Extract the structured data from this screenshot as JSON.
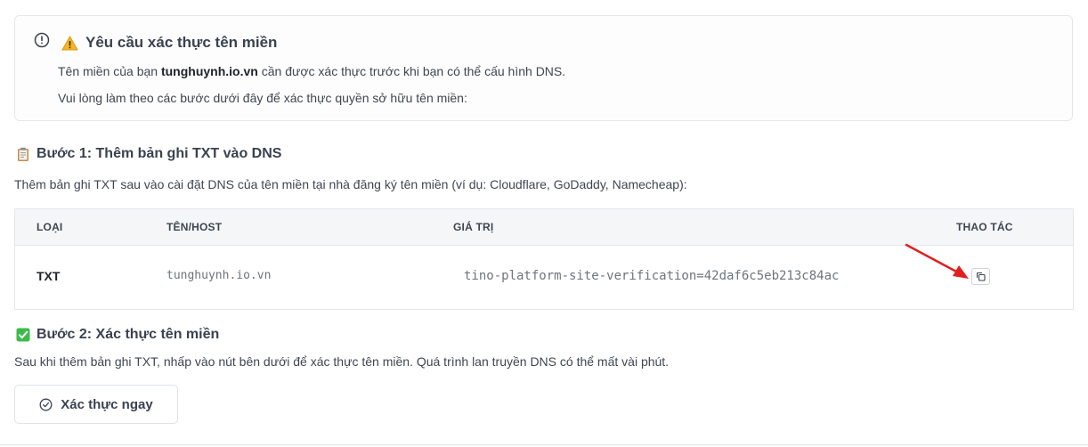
{
  "alert": {
    "title": "Yêu cầu xác thực tên miền",
    "line1_prefix": "Tên miền của bạn ",
    "line1_domain": "tunghuynh.io.vn",
    "line1_suffix": " cần được xác thực trước khi bạn có thể cấu hình DNS.",
    "line2": "Vui lòng làm theo các bước dưới đây để xác thực quyền sở hữu tên miền:"
  },
  "step1": {
    "title": "Bước 1: Thêm bản ghi TXT vào DNS",
    "description": "Thêm bản ghi TXT sau vào cài đặt DNS của tên miền tại nhà đăng ký tên miền (ví dụ: Cloudflare, GoDaddy, Namecheap):"
  },
  "table": {
    "headers": [
      "LOẠI",
      "TÊN/HOST",
      "GIÁ TRỊ",
      "THAO TÁC"
    ],
    "row": {
      "type": "TXT",
      "host": "tunghuynh.io.vn",
      "value": "tino-platform-site-verification=42daf6c5eb213c84ac"
    }
  },
  "step2": {
    "title": "Bước 2: Xác thực tên miền",
    "description": "Sau khi thêm bản ghi TXT, nhấp vào nút bên dưới để xác thực tên miền. Quá trình lan truyền DNS có thể mất vài phút."
  },
  "verify_button": {
    "label": "Xác thực ngay"
  },
  "icons": {
    "alert": "info-circle-icon",
    "warning": "warning-icon",
    "step1": "clipboard-icon",
    "step2": "check-box-icon",
    "copy": "copy-icon",
    "verify": "check-circle-icon"
  },
  "colors": {
    "annotation_arrow": "#e02020",
    "step2_check": "#3dbb4a"
  }
}
